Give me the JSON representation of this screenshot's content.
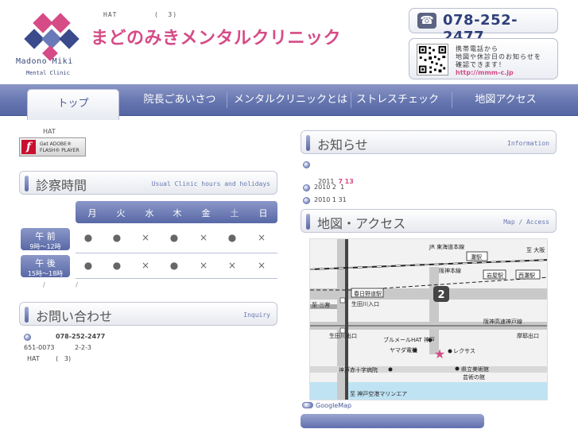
{
  "header": {
    "logo_name": "Madono Miki",
    "logo_sub": "Mental Clinic",
    "tagline": "HAT        (  3)",
    "site_title": "まどのみきメンタルクリニック",
    "phone": "078-252-2477",
    "mobile_notice": [
      "携帯電話から",
      "地図や休診日のお知らせを",
      "確認できます！"
    ],
    "mobile_url": "http://mmm-c.jp"
  },
  "nav": {
    "items": [
      {
        "label": "トップ"
      },
      {
        "label": "院長ごあいさつ"
      },
      {
        "label": "メンタルクリニックとは"
      },
      {
        "label": "ストレスチェック"
      },
      {
        "label": "地図アクセス"
      }
    ]
  },
  "left": {
    "hat_note": "HAT",
    "flash": {
      "line1": "Get ADOBE®",
      "line2": "FLASH® PLAYER"
    },
    "hours": {
      "title": "診察時間",
      "title_en": "Usual Clinic hours and holidays",
      "days": [
        "月",
        "火",
        "水",
        "木",
        "金",
        "土",
        "日"
      ],
      "rows": [
        {
          "label": "午 前",
          "time": "9時〜12時",
          "marks": [
            "●",
            "●",
            "×",
            "●",
            "×",
            "●",
            "×"
          ]
        },
        {
          "label": "午 後",
          "time": "15時〜18時",
          "marks": [
            "●",
            "●",
            "×",
            "●",
            "×",
            "×",
            "×"
          ]
        }
      ],
      "note": "/ /"
    },
    "contact": {
      "title": "お問い合わせ",
      "title_en": "Inquiry",
      "phone": "078-252-2477",
      "address1": "651-0073          2-2-3",
      "address2": "HAT        (   3)"
    }
  },
  "right": {
    "news": {
      "title": "お知らせ",
      "title_en": "Information",
      "items": [
        {
          "date": "2011",
          "m": "7",
          "d": "13"
        },
        {
          "date": "2010 2  1"
        },
        {
          "date": "2010 1 31"
        }
      ]
    },
    "access": {
      "title": "地図・アクセス",
      "title_en": "Map / Access",
      "map_labels": {
        "jr": "JR 東海道本線",
        "nada": "灘駅",
        "to_osaka": "至 大阪",
        "hanshin": "阪神本線",
        "iwaya": "岩屋駅",
        "nishinada": "西灘駅",
        "kasuganomichi": "春日野道駅",
        "to_sannomiya": "至 三宮",
        "ikutagawa_iriguchi": "生田川入口",
        "ikutagawa_deguchi": "生田川出口",
        "route2": "2",
        "expressway": "阪神高速神戸線",
        "makaide": "摩耶出口",
        "bldg": "ブルメールHAT 神戸",
        "yamada": "ヤマダ電機",
        "lexus": "レクサス",
        "redcross": "神戸赤十字病院",
        "museum1": "県立美術館",
        "museum2": "芸術の館",
        "to_airport": "至 神戸空港マリンエア"
      },
      "google_map": "GoogleMap"
    }
  },
  "colors": {
    "brand_pink": "#d64b86",
    "brand_navy": "#2f3f7a",
    "nav_blue": "#6676b0"
  }
}
